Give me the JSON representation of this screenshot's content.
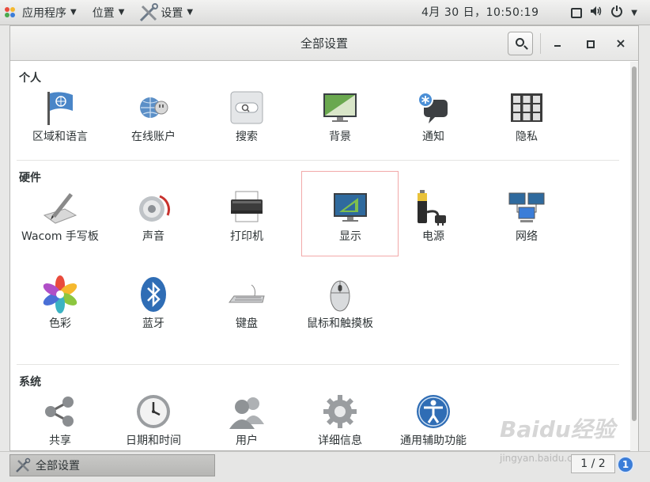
{
  "top_panel": {
    "applications": "应用程序",
    "places": "位置",
    "settings": "设置",
    "clock": "4月 30 日，10:50:19"
  },
  "window": {
    "title": "全部设置"
  },
  "sections": {
    "personal": {
      "title": "个人",
      "items": [
        "区域和语言",
        "在线账户",
        "搜索",
        "背景",
        "通知",
        "隐私"
      ]
    },
    "hardware": {
      "title": "硬件",
      "items": [
        "Wacom 手写板",
        "声音",
        "打印机",
        "显示",
        "电源",
        "网络",
        "色彩",
        "蓝牙",
        "键盘",
        "鼠标和触摸板"
      ]
    },
    "system": {
      "title": "系统",
      "items": [
        "共享",
        "日期和时间",
        "用户",
        "详细信息",
        "通用辅助功能"
      ]
    }
  },
  "taskbar": {
    "task_label": "全部设置",
    "pager": "1 / 2",
    "workspace_badge": "1"
  },
  "watermark": {
    "brand": "Baidu经验",
    "url": "jingyan.baidu.com"
  },
  "colors": {
    "accent": "#3b7dd8",
    "selection_border": "#f2a9a9"
  },
  "icons": {
    "personal": [
      "flag-icon",
      "online-accounts-icon",
      "search-icon",
      "background-icon",
      "notification-icon",
      "privacy-icon"
    ],
    "hardware": [
      "wacom-tablet-icon",
      "sound-icon",
      "printer-icon",
      "display-icon",
      "power-icon",
      "network-icon",
      "color-icon",
      "bluetooth-icon",
      "keyboard-icon",
      "mouse-icon"
    ],
    "system": [
      "sharing-icon",
      "clock-icon",
      "users-icon",
      "gear-icon",
      "accessibility-icon"
    ]
  }
}
